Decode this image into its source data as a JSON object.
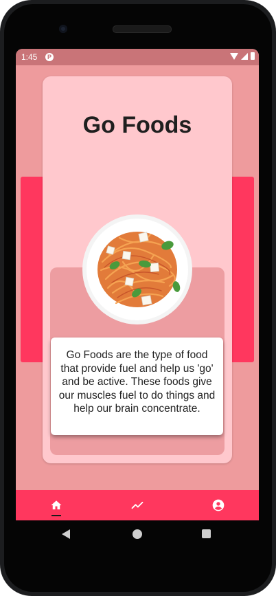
{
  "status_bar": {
    "time": "1:45",
    "app_badge": "P"
  },
  "card": {
    "title": "Go Foods",
    "description": "Go Foods are the type of food that provide fuel and help us 'go' and be active. These foods give our muscles fuel to do things and help our brain concentrate."
  },
  "bottom_nav": {
    "items": [
      {
        "icon": "home-icon",
        "selected": true
      },
      {
        "icon": "trending-icon",
        "selected": false
      },
      {
        "icon": "account-icon",
        "selected": false
      }
    ]
  },
  "colors": {
    "background": "#ee9b9d",
    "card": "#ffc8cd",
    "accent": "#ff375e",
    "inner_box": "#ed9da1",
    "status_bar": "#c97478"
  }
}
